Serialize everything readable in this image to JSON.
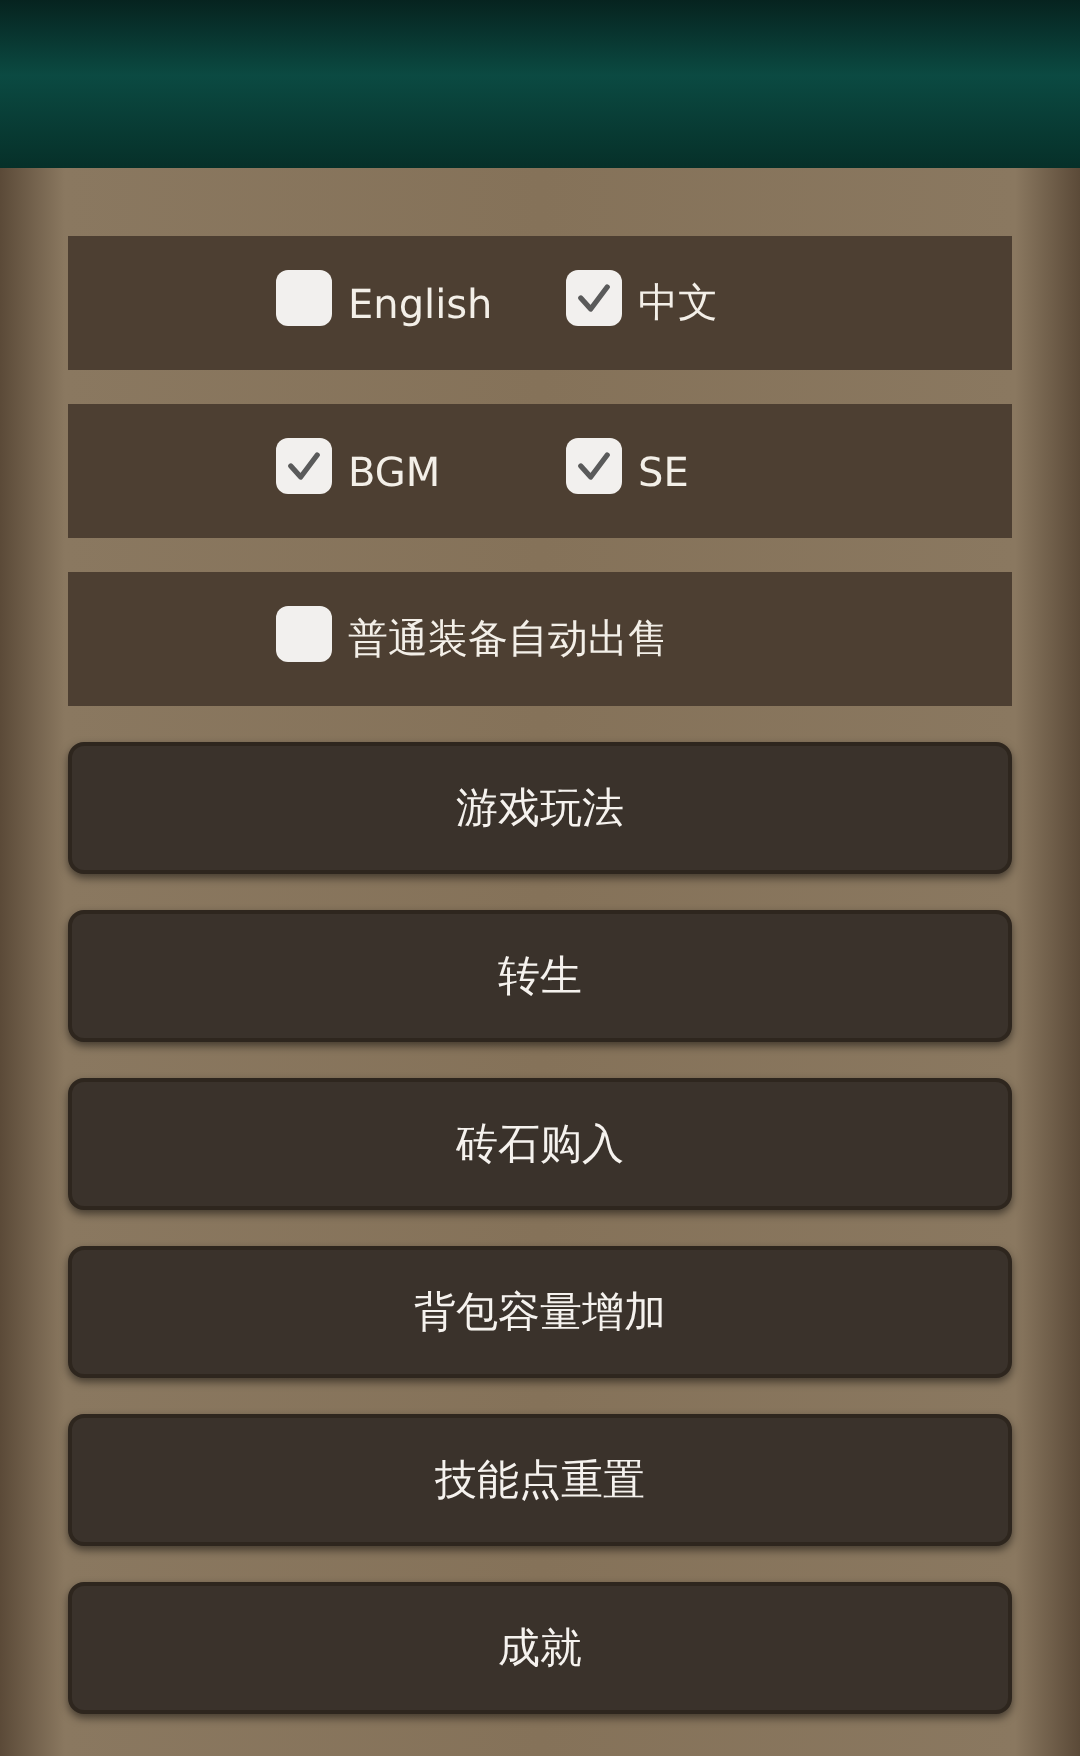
{
  "option_rows": [
    {
      "options": [
        {
          "label": "English",
          "checked": false
        },
        {
          "label": "中文",
          "checked": true
        }
      ]
    },
    {
      "options": [
        {
          "label": "BGM",
          "checked": true
        },
        {
          "label": "SE",
          "checked": true
        }
      ]
    },
    {
      "options": [
        {
          "label": "普通装备自动出售",
          "checked": false
        }
      ]
    }
  ],
  "buttons": [
    "游戏玩法",
    "转生",
    "砖石购入",
    "背包容量增加",
    "技能点重置",
    "成就"
  ]
}
